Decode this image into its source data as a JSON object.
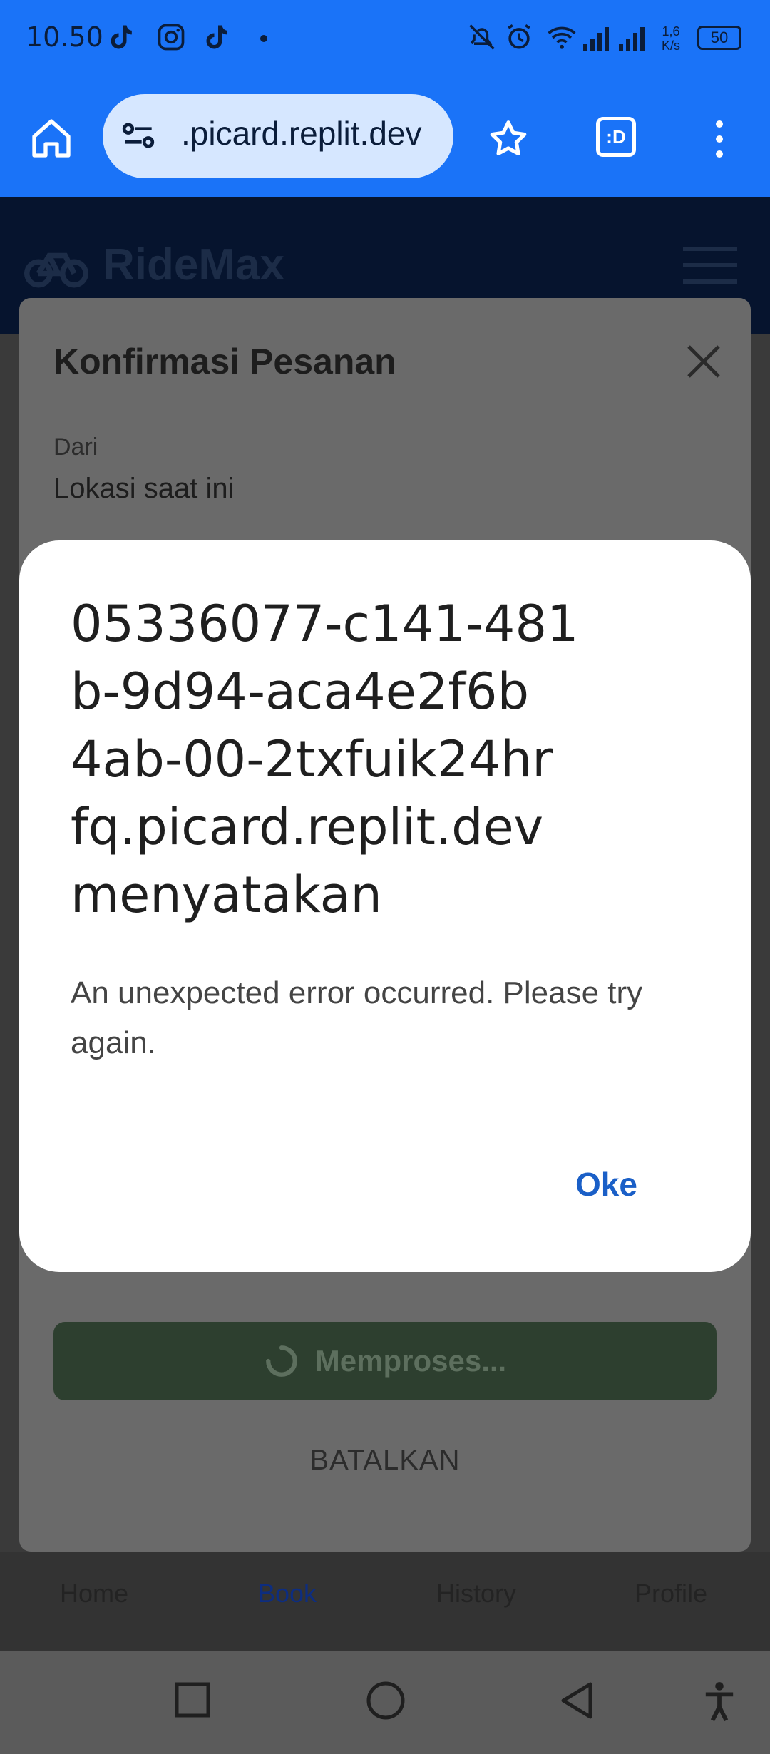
{
  "status_bar": {
    "time": "10.50",
    "net_speed_top": "1,6",
    "net_speed_bottom": "K/s",
    "battery": "50"
  },
  "browser": {
    "url": ".picard.replit.dev",
    "icons": [
      "home-icon",
      "site-settings-icon",
      "star-icon",
      "tab-switcher-icon",
      "more-vert-icon"
    ],
    "tab_label": ":D"
  },
  "site": {
    "brand": "RideMax"
  },
  "sheet": {
    "title": "Konfirmasi Pesanan",
    "from_label": "Dari",
    "from_value": "Lokasi saat ini",
    "process_label": "Memproses...",
    "cancel_label": "BATALKAN"
  },
  "bottom_nav": [
    {
      "label": "Home",
      "icon": "home-icon"
    },
    {
      "label": "Book",
      "icon": "bike-icon"
    },
    {
      "label": "History",
      "icon": "history-icon"
    },
    {
      "label": "Profile",
      "icon": "profile-icon"
    }
  ],
  "dialog": {
    "title": "05336077-c141-481b-9d94-aca4e2f6b4ab-00-2txfuik24hrfq.picard.replit.dev menyatakan",
    "title_lines": [
      "05336077-c141-481",
      "b-9d94-aca4e2f6b",
      "4ab-00-2txfuik24hr",
      "fq.picard.replit.dev",
      "menyatakan"
    ],
    "message": "An unexpected error occurred. Please try again.",
    "ok_label": "Oke"
  },
  "colors": {
    "browser_bar": "#1a73f8",
    "header": "#06142e",
    "link": "#1a5fc7"
  }
}
